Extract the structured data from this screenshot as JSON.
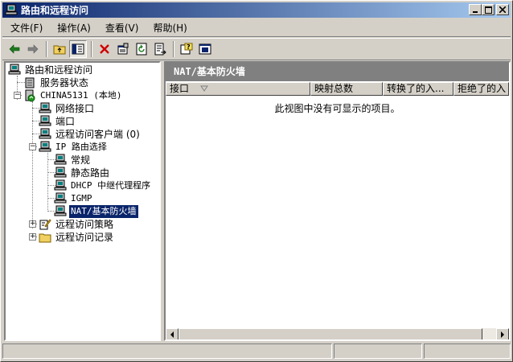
{
  "window": {
    "title": "路由和远程访问"
  },
  "menubar": {
    "items": [
      {
        "label": "文件(F)"
      },
      {
        "label": "操作(A)"
      },
      {
        "label": "查看(V)"
      },
      {
        "label": "帮助(H)"
      }
    ]
  },
  "toolbar": {
    "icons": [
      "back-arrow-icon",
      "forward-arrow-icon",
      "up-folder-icon",
      "show-hide-tree-icon",
      "delete-icon",
      "properties-icon",
      "refresh-icon",
      "export-list-icon",
      "help-icon",
      "console-icon"
    ]
  },
  "tree": {
    "root": "路由和远程访问",
    "server_status": "服务器状态",
    "server": "CHINA5131 (本地)",
    "network_interfaces": "网络接口",
    "ports": "端口",
    "remote_clients": "远程访问客户端 (0)",
    "ip_routing": "IP 路由选择",
    "general": "常规",
    "static_routes": "静态路由",
    "dhcp_relay": "DHCP 中继代理程序",
    "igmp": "IGMP",
    "nat_firewall": "NAT/基本防火墙",
    "remote_policies": "远程访问策略",
    "remote_logging": "远程访问记录"
  },
  "right_pane": {
    "header": "NAT/基本防火墙",
    "columns": [
      {
        "label": "接口"
      },
      {
        "label": "映射总数"
      },
      {
        "label": "转换了的入..."
      },
      {
        "label": "拒绝了的入"
      }
    ],
    "empty_message": "此视图中没有可显示的项目。"
  },
  "colors": {
    "title_start": "#0a246a",
    "title_end": "#a6caf0",
    "selection": "#0a246a",
    "face": "#d4d0c8"
  }
}
